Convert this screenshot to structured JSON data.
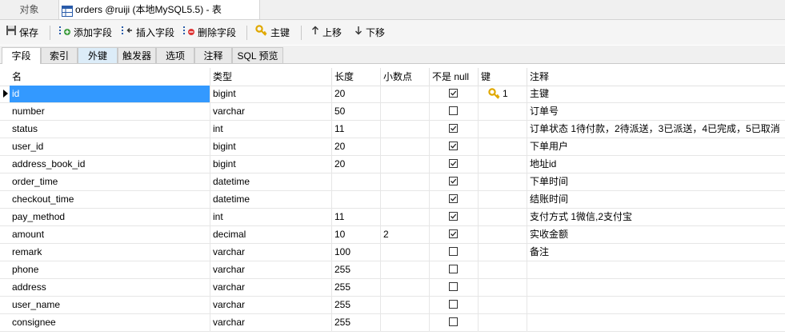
{
  "tabs": {
    "objects": "对象",
    "table": "orders @ruiji (本地MySQL5.5) - 表"
  },
  "toolbar": {
    "save": "保存",
    "add_field": "添加字段",
    "insert_field": "插入字段",
    "delete_field": "删除字段",
    "primary_key": "主键",
    "move_up": "上移",
    "move_down": "下移"
  },
  "subtabs": [
    "字段",
    "索引",
    "外键",
    "触发器",
    "选项",
    "注释",
    "SQL 预览"
  ],
  "columns": {
    "name": "名",
    "type": "类型",
    "length": "长度",
    "decimals": "小数点",
    "not_null": "不是 null",
    "key": "键",
    "comment": "注释"
  },
  "rows": [
    {
      "name": "id",
      "type": "bigint",
      "length": "20",
      "decimals": "",
      "not_null": true,
      "key": "1",
      "comment": "主键"
    },
    {
      "name": "number",
      "type": "varchar",
      "length": "50",
      "decimals": "",
      "not_null": false,
      "key": "",
      "comment": "订单号"
    },
    {
      "name": "status",
      "type": "int",
      "length": "11",
      "decimals": "",
      "not_null": true,
      "key": "",
      "comment": "订单状态 1待付款，2待派送，3已派送，4已完成，5已取消"
    },
    {
      "name": "user_id",
      "type": "bigint",
      "length": "20",
      "decimals": "",
      "not_null": true,
      "key": "",
      "comment": "下单用户"
    },
    {
      "name": "address_book_id",
      "type": "bigint",
      "length": "20",
      "decimals": "",
      "not_null": true,
      "key": "",
      "comment": "地址id"
    },
    {
      "name": "order_time",
      "type": "datetime",
      "length": "",
      "decimals": "",
      "not_null": true,
      "key": "",
      "comment": "下单时间"
    },
    {
      "name": "checkout_time",
      "type": "datetime",
      "length": "",
      "decimals": "",
      "not_null": true,
      "key": "",
      "comment": "结账时间"
    },
    {
      "name": "pay_method",
      "type": "int",
      "length": "11",
      "decimals": "",
      "not_null": true,
      "key": "",
      "comment": "支付方式 1微信,2支付宝"
    },
    {
      "name": "amount",
      "type": "decimal",
      "length": "10",
      "decimals": "2",
      "not_null": true,
      "key": "",
      "comment": "实收金额"
    },
    {
      "name": "remark",
      "type": "varchar",
      "length": "100",
      "decimals": "",
      "not_null": false,
      "key": "",
      "comment": "备注"
    },
    {
      "name": "phone",
      "type": "varchar",
      "length": "255",
      "decimals": "",
      "not_null": false,
      "key": "",
      "comment": ""
    },
    {
      "name": "address",
      "type": "varchar",
      "length": "255",
      "decimals": "",
      "not_null": false,
      "key": "",
      "comment": ""
    },
    {
      "name": "user_name",
      "type": "varchar",
      "length": "255",
      "decimals": "",
      "not_null": false,
      "key": "",
      "comment": ""
    },
    {
      "name": "consignee",
      "type": "varchar",
      "length": "255",
      "decimals": "",
      "not_null": false,
      "key": "",
      "comment": ""
    }
  ],
  "icons": {
    "table_tab": "table-icon",
    "save": "save-icon",
    "add_field": "add-field-icon",
    "insert_field": "insert-field-icon",
    "delete_field": "delete-field-icon",
    "primary_key": "key-icon",
    "move_up": "arrow-up-icon",
    "move_down": "arrow-down-icon"
  },
  "colors": {
    "selection": "#3399ff",
    "key_gold": "#e0a800"
  }
}
